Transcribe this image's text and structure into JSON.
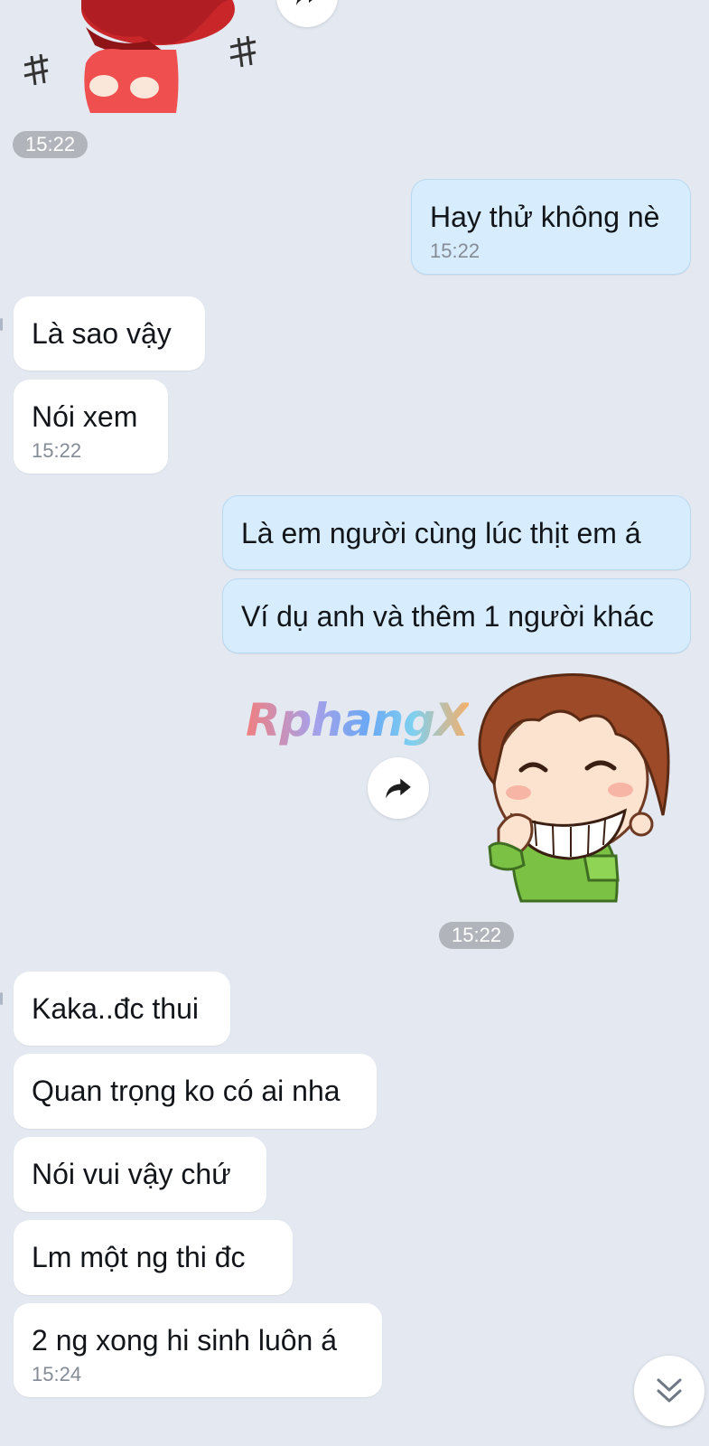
{
  "messages": [
    {
      "direction": "outgoing",
      "text": "Hay thử không nè",
      "time": "15:22"
    },
    {
      "direction": "incoming",
      "text": "Là sao vậy"
    },
    {
      "direction": "incoming",
      "text": "Nói xem",
      "time": "15:22"
    },
    {
      "direction": "outgoing",
      "text": "Là em người cùng lúc thịt em á"
    },
    {
      "direction": "outgoing",
      "text": "Ví dụ anh và thêm 1 người khác"
    },
    {
      "direction": "incoming",
      "text": "Kaka..đc thui"
    },
    {
      "direction": "incoming",
      "text": "Quan trọng ko có ai nha"
    },
    {
      "direction": "incoming",
      "text": "Nói vui vậy chứ"
    },
    {
      "direction": "incoming",
      "text": "Lm một ng thi đc"
    },
    {
      "direction": "incoming",
      "text": "2 ng xong hi sinh luôn á",
      "time": "15:24"
    }
  ],
  "stickers": {
    "top_sticker_time": "15:22",
    "boy_sticker_time": "15:22"
  },
  "watermark": "RphangX",
  "icons": {
    "share": "share-arrow-icon",
    "scroll_down": "double-chevron-down-icon"
  },
  "colors": {
    "background": "#e3e8f1",
    "incoming_bubble": "#ffffff",
    "outgoing_bubble": "#d7edfd",
    "timestamp_pill": "#b1b5bb"
  }
}
